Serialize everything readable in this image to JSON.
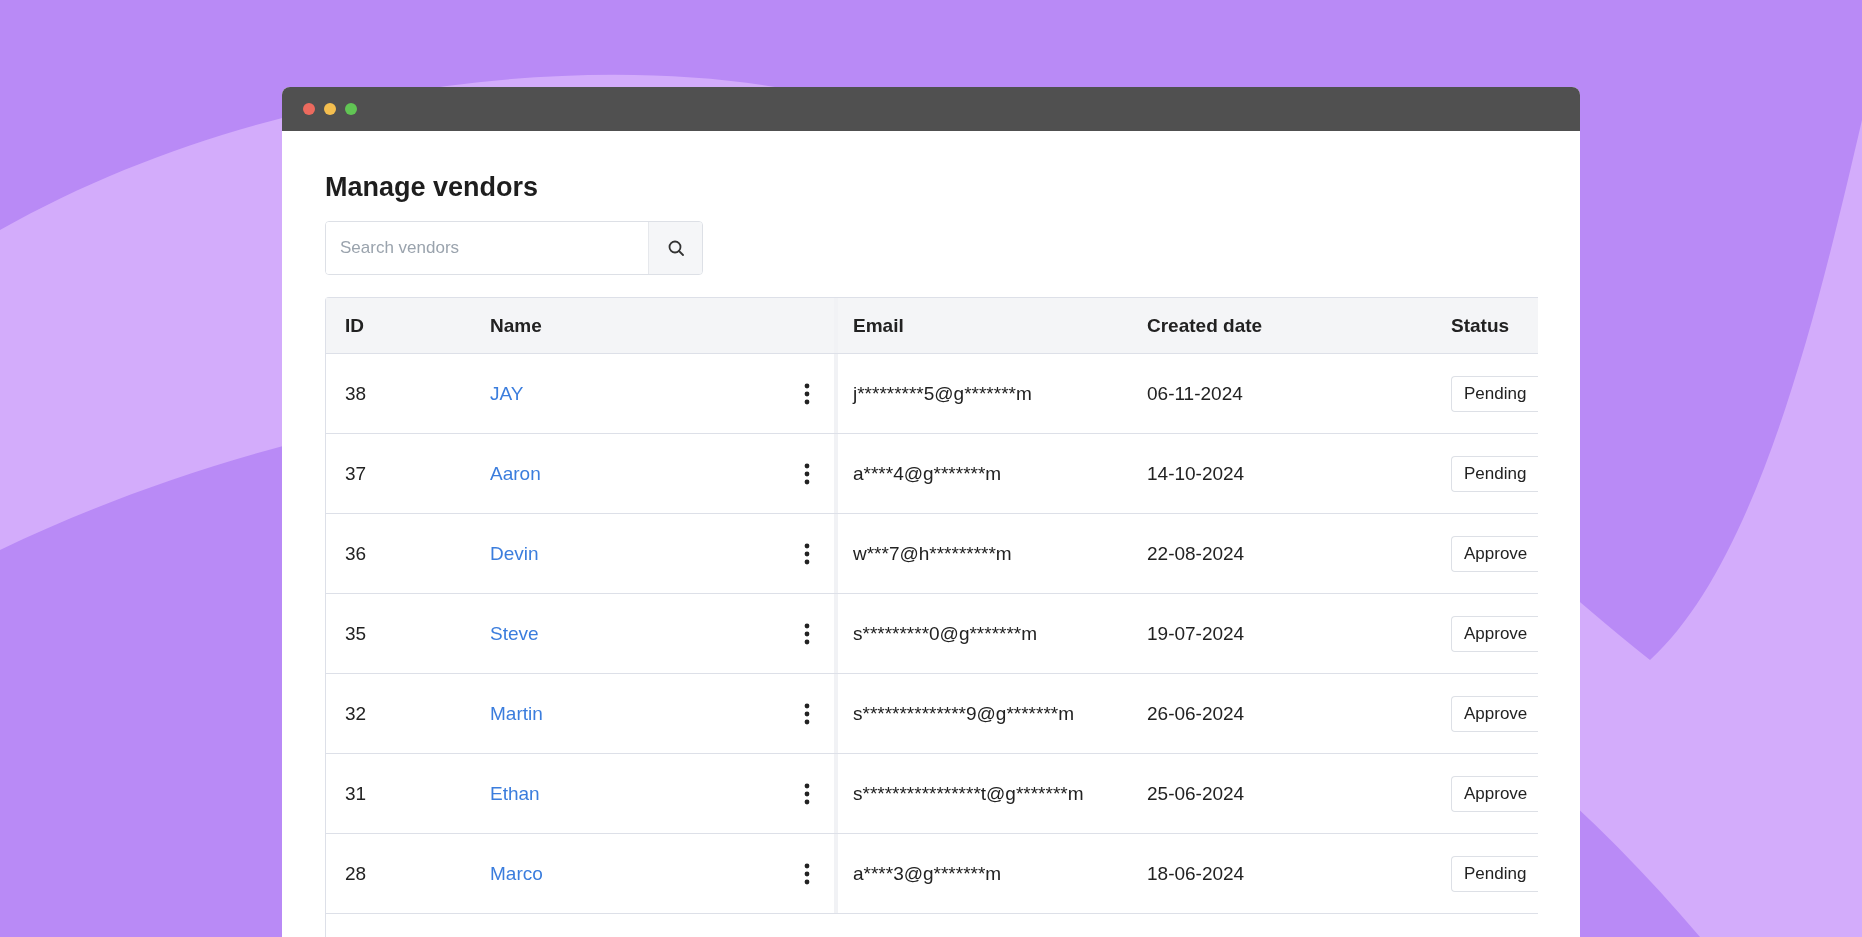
{
  "page": {
    "title": "Manage vendors"
  },
  "search": {
    "placeholder": "Search vendors"
  },
  "table": {
    "columns": [
      "ID",
      "Name",
      "Email",
      "Created date",
      "Status"
    ],
    "rows": [
      {
        "id": "38",
        "name": "JAY",
        "email": "j*********5@g*******m",
        "created": "06-11-2024",
        "status": "Pending"
      },
      {
        "id": "37",
        "name": "Aaron",
        "email": "a****4@g*******m",
        "created": "14-10-2024",
        "status": "Pending"
      },
      {
        "id": "36",
        "name": "Devin",
        "email": "w***7@h*********m",
        "created": "22-08-2024",
        "status": "Approve"
      },
      {
        "id": "35",
        "name": "Steve",
        "email": "s*********0@g*******m",
        "created": "19-07-2024",
        "status": "Approve"
      },
      {
        "id": "32",
        "name": "Martin",
        "email": "s**************9@g*******m",
        "created": "26-06-2024",
        "status": "Approve"
      },
      {
        "id": "31",
        "name": "Ethan",
        "email": "s****************t@g*******m",
        "created": "25-06-2024",
        "status": "Approve"
      },
      {
        "id": "28",
        "name": "Marco",
        "email": "a****3@g*******m",
        "created": "18-06-2024",
        "status": "Pending"
      }
    ]
  }
}
